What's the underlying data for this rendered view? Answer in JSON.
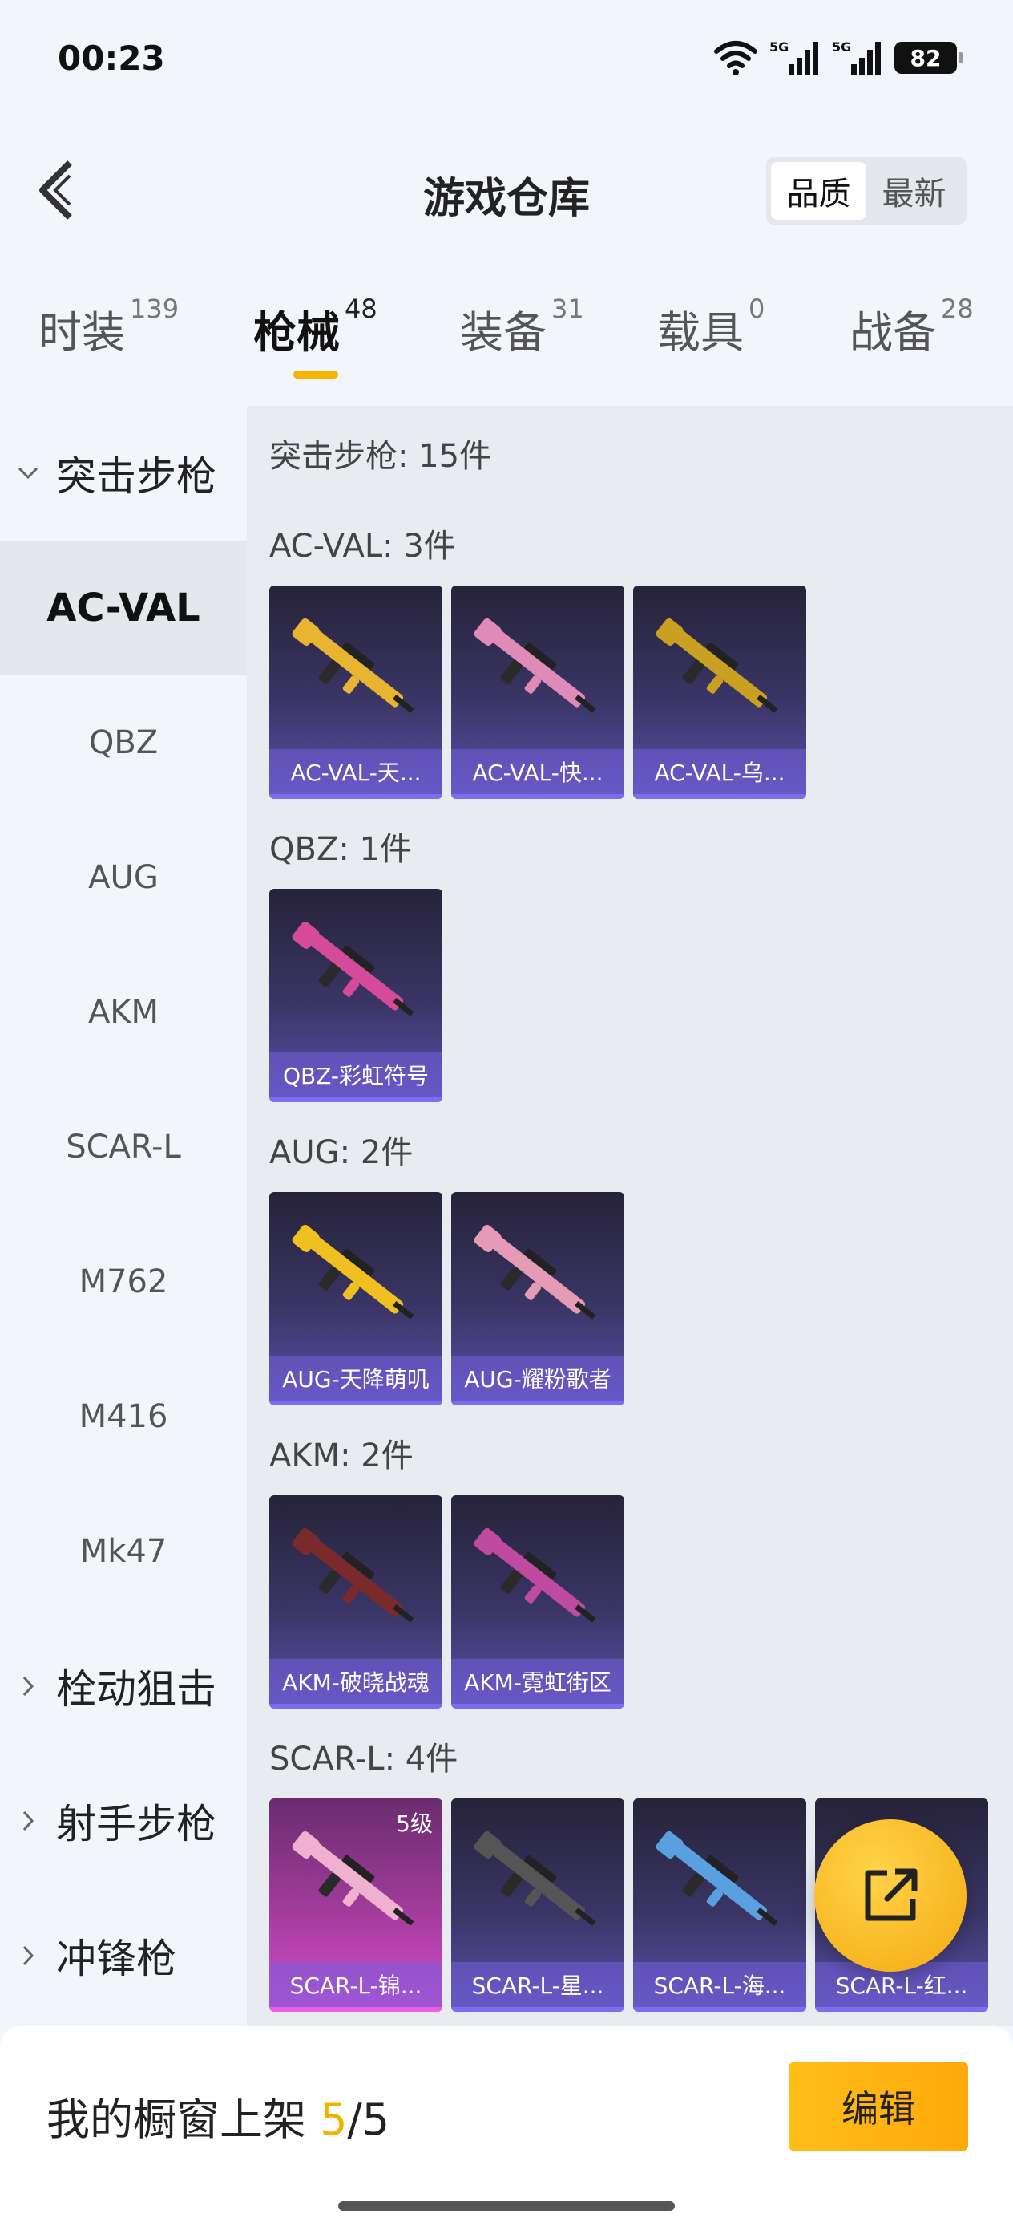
{
  "status_bar": {
    "time": "00:23",
    "battery": "82",
    "network_1": "5G",
    "network_2": "5G"
  },
  "header": {
    "title": "游戏仓库",
    "sort_options": [
      "品质",
      "最新"
    ],
    "sort_selected": "品质"
  },
  "tabs": [
    {
      "label": "时装",
      "count": "139"
    },
    {
      "label": "枪械",
      "count": "48"
    },
    {
      "label": "装备",
      "count": "31"
    },
    {
      "label": "载具",
      "count": "0"
    },
    {
      "label": "战备",
      "count": "28"
    }
  ],
  "active_tab": "枪械",
  "sidebar": {
    "groups": [
      {
        "label": "突击步枪",
        "expanded": true
      },
      {
        "label": "栓动狙击",
        "expanded": false
      },
      {
        "label": "射手步枪",
        "expanded": false
      },
      {
        "label": "冲锋枪",
        "expanded": false
      }
    ],
    "items": [
      "AC-VAL",
      "QBZ",
      "AUG",
      "AKM",
      "SCAR-L",
      "M762",
      "M416",
      "Mk47"
    ],
    "active_item": "AC-VAL"
  },
  "content": {
    "category_header": "突击步枪: 15件",
    "sections": [
      {
        "header": "AC-VAL: 3件",
        "items": [
          {
            "label": "AC-VAL-天...",
            "gun_color": "#e8b530"
          },
          {
            "label": "AC-VAL-快...",
            "gun_color": "#e08ab8"
          },
          {
            "label": "AC-VAL-乌...",
            "gun_color": "#c9a020"
          }
        ]
      },
      {
        "header": "QBZ: 1件",
        "items": [
          {
            "label": "QBZ-彩虹符号",
            "gun_color": "#d64a9a"
          }
        ]
      },
      {
        "header": "AUG: 2件",
        "items": [
          {
            "label": "AUG-天降萌叽",
            "gun_color": "#f0c020"
          },
          {
            "label": "AUG-耀粉歌者",
            "gun_color": "#e59ab5"
          }
        ]
      },
      {
        "header": "AKM: 2件",
        "items": [
          {
            "label": "AKM-破晓战魂",
            "gun_color": "#7a2a2a"
          },
          {
            "label": "AKM-霓虹街区",
            "gun_color": "#c04aa0"
          }
        ]
      },
      {
        "header": "SCAR-L: 4件",
        "items": [
          {
            "label": "SCAR-L-锦...",
            "gun_color": "#f0b0d0",
            "level": "5级",
            "rarity": "pink"
          },
          {
            "label": "SCAR-L-星...",
            "gun_color": "#555555"
          },
          {
            "label": "SCAR-L-海...",
            "gun_color": "#5aa0e0"
          },
          {
            "label": "SCAR-L-红...",
            "gun_color": "#c03030"
          }
        ]
      }
    ]
  },
  "bottom_bar": {
    "showcase_prefix": "我的橱窗上架 ",
    "showcase_current": "5",
    "showcase_total": "/5",
    "edit_label": "编辑"
  },
  "colors": {
    "accent": "#f5b400",
    "card_bg": "#3a3566",
    "card_border": "#7d6bf0"
  }
}
